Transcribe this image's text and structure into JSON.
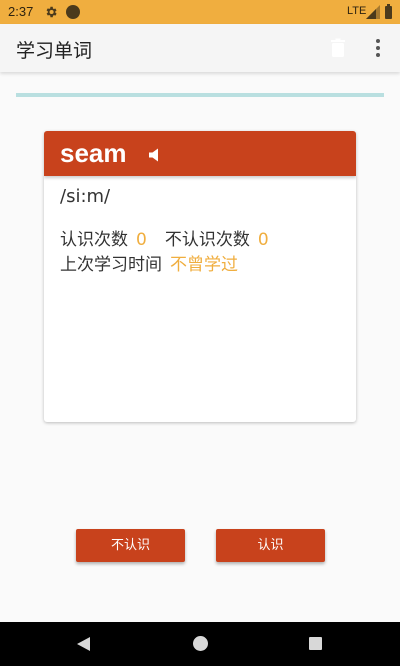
{
  "status_bar": {
    "time": "2:37",
    "network": "LTE",
    "icons": [
      "gear-icon",
      "notification-dot-icon",
      "signal-icon",
      "battery-icon"
    ],
    "background_color": "#f0ae3f"
  },
  "app_bar": {
    "title": "学习单词",
    "actions": [
      "trash-icon",
      "more-vert-icon"
    ]
  },
  "progress": {
    "fraction": 1.0,
    "color": "#b9dfe0"
  },
  "word_card": {
    "word": "seam",
    "phonetic": "/si:m/",
    "speaker_icon": "volume-icon",
    "known_count_label": "认识次数",
    "known_count_value": "0",
    "unknown_count_label": "不认识次数",
    "unknown_count_value": "0",
    "last_studied_label": "上次学习时间",
    "last_studied_value": "不曾学过",
    "header_color": "#c8421c",
    "value_color": "#f0ae3f"
  },
  "actions": {
    "unknown_label": "不认识",
    "known_label": "认识"
  },
  "nav_bar": {
    "buttons": [
      "back-icon",
      "home-icon",
      "recents-icon"
    ]
  }
}
